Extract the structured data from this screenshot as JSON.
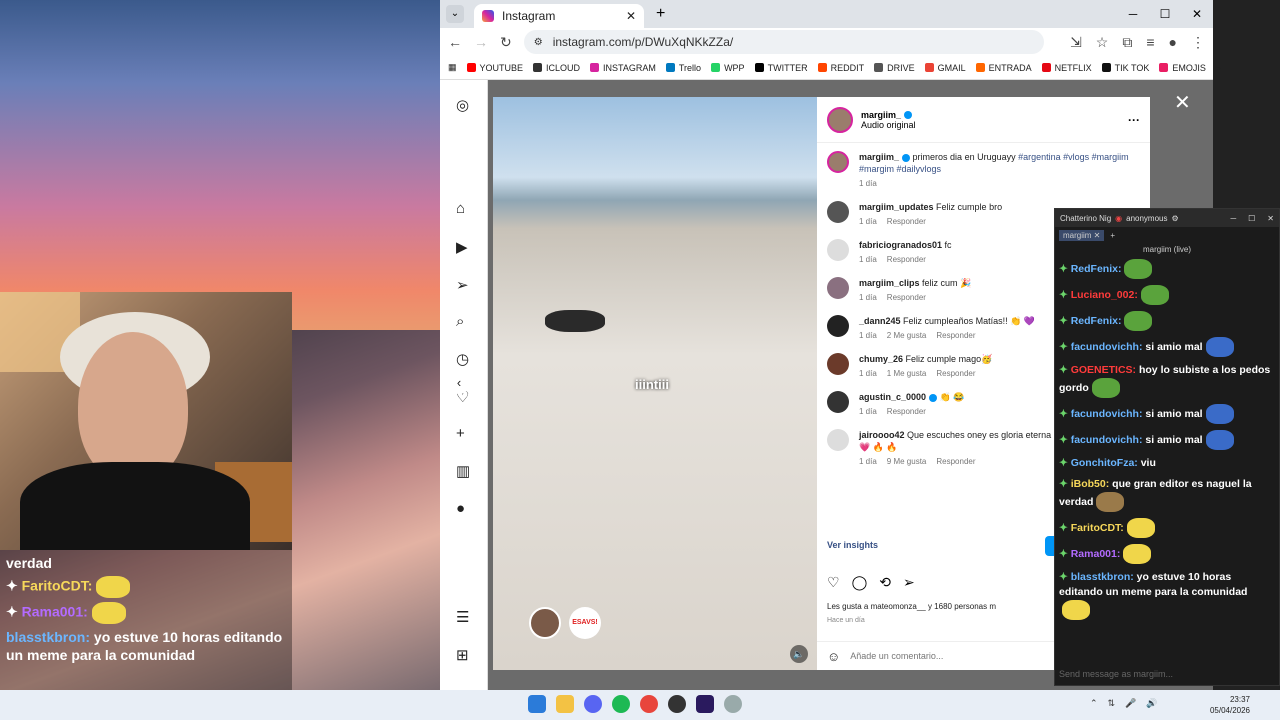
{
  "overlay_chat": [
    {
      "user": "",
      "text": "verdad",
      "user_color": ""
    },
    {
      "user": "FaritoCDT:",
      "text": "",
      "user_color": "yellow"
    },
    {
      "user": "Rama001:",
      "text": "",
      "user_color": "purple"
    },
    {
      "user": "blasstkbron:",
      "text": "yo estuve 10 horas editando un meme para la comunidad",
      "user_color": "blue"
    }
  ],
  "browser": {
    "tab_title": "Instagram",
    "url": "instagram.com/p/DWuXqNKkZZa/",
    "bookmarks": [
      "YOUTUBE",
      "ICLOUD",
      "INSTAGRAM",
      "Trello",
      "WPP",
      "TWITTER",
      "REDDIT",
      "DRIVE",
      "GMAIL",
      "ENTRADA",
      "NETFLIX",
      "TIK TOK",
      "EMOJIS"
    ]
  },
  "post": {
    "author": "margiim_",
    "audio": "Audio original",
    "video_caption": "iiintiii",
    "video_overlay_badge": "ESAVS!",
    "caption_user": "margiim_",
    "caption_text": "primeros dia en Uruguayy",
    "caption_hashtags": "#argentina #vlogs #margiim #margim #dailyvlogs",
    "caption_age": "1 día",
    "comments": [
      {
        "user": "margiim_updates",
        "text": "Feliz cumple bro",
        "age": "1 día",
        "likes": "",
        "reply": "Responder"
      },
      {
        "user": "fabriciogranados01",
        "text": "fc",
        "age": "1 día",
        "likes": "",
        "reply": "Responder"
      },
      {
        "user": "margiim_clips",
        "text": "feliz cum 🎉",
        "age": "1 día",
        "likes": "",
        "reply": "Responder"
      },
      {
        "user": "_dann245",
        "text": "Feliz cumpleaños Matías!! 👏 💜",
        "age": "1 día",
        "likes": "2 Me gusta",
        "reply": "Responder"
      },
      {
        "user": "chumy_26",
        "text": "Feliz cumple mago🥳",
        "age": "1 día",
        "likes": "1 Me gusta",
        "reply": "Responder"
      },
      {
        "user": "agustin_c_0000",
        "text": "👏 😂",
        "age": "1 día",
        "likes": "",
        "reply": "Responder"
      },
      {
        "user": "jairoooo42",
        "text": "Que escuches oney es gloria eterna cumple querido 👏 💗 🔥 🔥",
        "age": "1 día",
        "likes": "9 Me gusta",
        "reply": "Responder"
      }
    ],
    "insights": "Ver insights",
    "likes_text": "Les gusta a mateomonza__ y 1680 personas m",
    "posted_ago": "Hace un día",
    "add_comment_placeholder": "Añade un comentario..."
  },
  "chatterino": {
    "title": "Chatterino Nig",
    "user": "anonymous",
    "tab": "margiim",
    "channel": "margiim (live)",
    "messages": [
      {
        "user": "RedFenix:",
        "text": "",
        "color": "#6bb6ff",
        "emote": "g"
      },
      {
        "user": "Luciano_002:",
        "text": "",
        "color": "#ff3b3b",
        "emote": "g"
      },
      {
        "user": "RedFenix:",
        "text": "",
        "color": "#6bb6ff",
        "emote": "g"
      },
      {
        "user": "facundovichh:",
        "text": "si amio mal",
        "color": "#6bb6ff",
        "emote": "b"
      },
      {
        "user": "GOENETICS:",
        "text": "hoy lo subiste a los pedos gordo",
        "color": "#ff3b3b",
        "emote": "g"
      },
      {
        "user": "facundovichh:",
        "text": "si amio mal",
        "color": "#6bb6ff",
        "emote": "b"
      },
      {
        "user": "facundovichh:",
        "text": "si amio mal",
        "color": "#6bb6ff",
        "emote": "b"
      },
      {
        "user": "GonchitoFza:",
        "text": "viu",
        "color": "#6bb6ff",
        "emote": ""
      },
      {
        "user": "iBob50:",
        "text": "que gran editor es naguel la verdad",
        "color": "#f7d85a",
        "emote": "br"
      },
      {
        "user": "FaritoCDT:",
        "text": "",
        "color": "#f7d85a",
        "emote": "y"
      },
      {
        "user": "Rama001:",
        "text": "",
        "color": "#b36bff",
        "emote": "y"
      },
      {
        "user": "blasstkbron:",
        "text": "yo estuve 10 horas editando un meme para la comunidad",
        "color": "#6bb6ff",
        "emote": "y"
      }
    ],
    "input_placeholder": "Send message as margiim..."
  },
  "taskbar": {
    "time": "23:37",
    "date": "05/04/2026"
  }
}
